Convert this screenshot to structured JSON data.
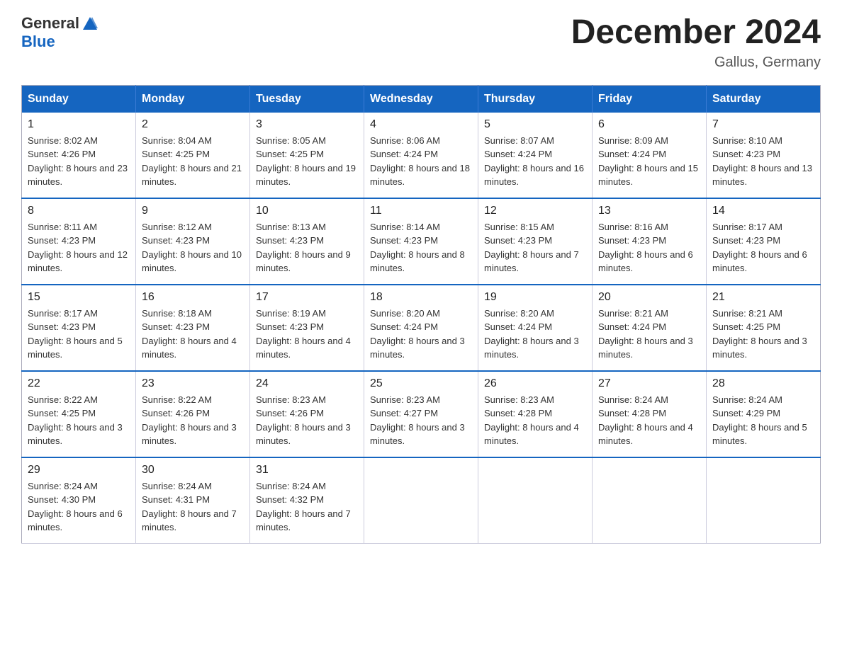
{
  "header": {
    "logo_general": "General",
    "logo_blue": "Blue",
    "month_title": "December 2024",
    "location": "Gallus, Germany"
  },
  "calendar": {
    "days_of_week": [
      "Sunday",
      "Monday",
      "Tuesday",
      "Wednesday",
      "Thursday",
      "Friday",
      "Saturday"
    ],
    "weeks": [
      [
        {
          "day": "1",
          "sunrise": "8:02 AM",
          "sunset": "4:26 PM",
          "daylight": "8 hours and 23 minutes."
        },
        {
          "day": "2",
          "sunrise": "8:04 AM",
          "sunset": "4:25 PM",
          "daylight": "8 hours and 21 minutes."
        },
        {
          "day": "3",
          "sunrise": "8:05 AM",
          "sunset": "4:25 PM",
          "daylight": "8 hours and 19 minutes."
        },
        {
          "day": "4",
          "sunrise": "8:06 AM",
          "sunset": "4:24 PM",
          "daylight": "8 hours and 18 minutes."
        },
        {
          "day": "5",
          "sunrise": "8:07 AM",
          "sunset": "4:24 PM",
          "daylight": "8 hours and 16 minutes."
        },
        {
          "day": "6",
          "sunrise": "8:09 AM",
          "sunset": "4:24 PM",
          "daylight": "8 hours and 15 minutes."
        },
        {
          "day": "7",
          "sunrise": "8:10 AM",
          "sunset": "4:23 PM",
          "daylight": "8 hours and 13 minutes."
        }
      ],
      [
        {
          "day": "8",
          "sunrise": "8:11 AM",
          "sunset": "4:23 PM",
          "daylight": "8 hours and 12 minutes."
        },
        {
          "day": "9",
          "sunrise": "8:12 AM",
          "sunset": "4:23 PM",
          "daylight": "8 hours and 10 minutes."
        },
        {
          "day": "10",
          "sunrise": "8:13 AM",
          "sunset": "4:23 PM",
          "daylight": "8 hours and 9 minutes."
        },
        {
          "day": "11",
          "sunrise": "8:14 AM",
          "sunset": "4:23 PM",
          "daylight": "8 hours and 8 minutes."
        },
        {
          "day": "12",
          "sunrise": "8:15 AM",
          "sunset": "4:23 PM",
          "daylight": "8 hours and 7 minutes."
        },
        {
          "day": "13",
          "sunrise": "8:16 AM",
          "sunset": "4:23 PM",
          "daylight": "8 hours and 6 minutes."
        },
        {
          "day": "14",
          "sunrise": "8:17 AM",
          "sunset": "4:23 PM",
          "daylight": "8 hours and 6 minutes."
        }
      ],
      [
        {
          "day": "15",
          "sunrise": "8:17 AM",
          "sunset": "4:23 PM",
          "daylight": "8 hours and 5 minutes."
        },
        {
          "day": "16",
          "sunrise": "8:18 AM",
          "sunset": "4:23 PM",
          "daylight": "8 hours and 4 minutes."
        },
        {
          "day": "17",
          "sunrise": "8:19 AM",
          "sunset": "4:23 PM",
          "daylight": "8 hours and 4 minutes."
        },
        {
          "day": "18",
          "sunrise": "8:20 AM",
          "sunset": "4:24 PM",
          "daylight": "8 hours and 3 minutes."
        },
        {
          "day": "19",
          "sunrise": "8:20 AM",
          "sunset": "4:24 PM",
          "daylight": "8 hours and 3 minutes."
        },
        {
          "day": "20",
          "sunrise": "8:21 AM",
          "sunset": "4:24 PM",
          "daylight": "8 hours and 3 minutes."
        },
        {
          "day": "21",
          "sunrise": "8:21 AM",
          "sunset": "4:25 PM",
          "daylight": "8 hours and 3 minutes."
        }
      ],
      [
        {
          "day": "22",
          "sunrise": "8:22 AM",
          "sunset": "4:25 PM",
          "daylight": "8 hours and 3 minutes."
        },
        {
          "day": "23",
          "sunrise": "8:22 AM",
          "sunset": "4:26 PM",
          "daylight": "8 hours and 3 minutes."
        },
        {
          "day": "24",
          "sunrise": "8:23 AM",
          "sunset": "4:26 PM",
          "daylight": "8 hours and 3 minutes."
        },
        {
          "day": "25",
          "sunrise": "8:23 AM",
          "sunset": "4:27 PM",
          "daylight": "8 hours and 3 minutes."
        },
        {
          "day": "26",
          "sunrise": "8:23 AM",
          "sunset": "4:28 PM",
          "daylight": "8 hours and 4 minutes."
        },
        {
          "day": "27",
          "sunrise": "8:24 AM",
          "sunset": "4:28 PM",
          "daylight": "8 hours and 4 minutes."
        },
        {
          "day": "28",
          "sunrise": "8:24 AM",
          "sunset": "4:29 PM",
          "daylight": "8 hours and 5 minutes."
        }
      ],
      [
        {
          "day": "29",
          "sunrise": "8:24 AM",
          "sunset": "4:30 PM",
          "daylight": "8 hours and 6 minutes."
        },
        {
          "day": "30",
          "sunrise": "8:24 AM",
          "sunset": "4:31 PM",
          "daylight": "8 hours and 7 minutes."
        },
        {
          "day": "31",
          "sunrise": "8:24 AM",
          "sunset": "4:32 PM",
          "daylight": "8 hours and 7 minutes."
        },
        null,
        null,
        null,
        null
      ]
    ],
    "labels": {
      "sunrise": "Sunrise:",
      "sunset": "Sunset:",
      "daylight": "Daylight:"
    }
  }
}
